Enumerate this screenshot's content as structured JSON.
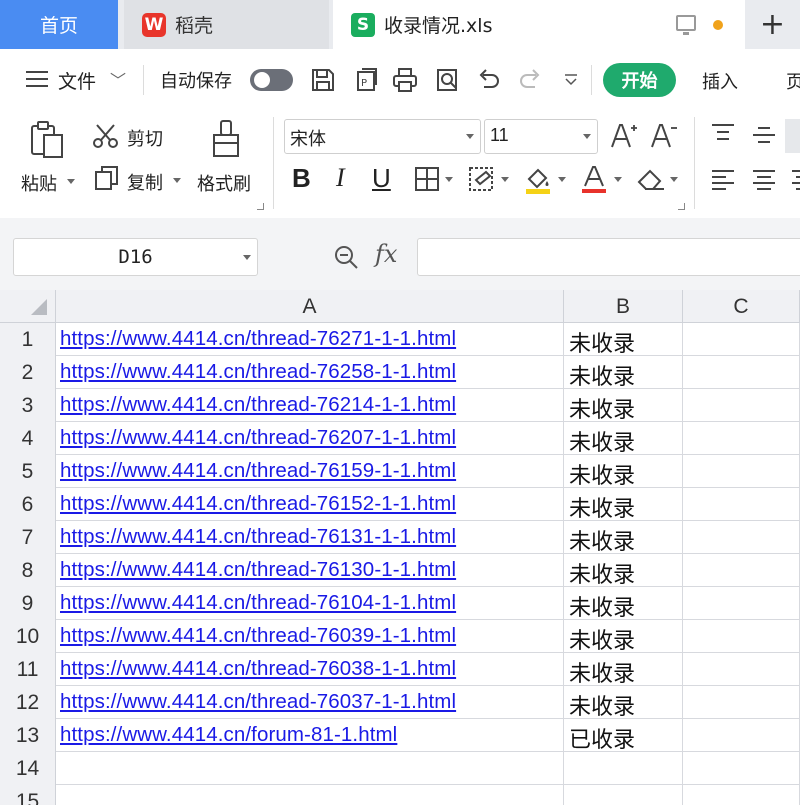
{
  "tabs": {
    "home": "首页",
    "daoke": "稻壳",
    "daoke_logo": "W",
    "file": "收录情况.xls",
    "file_logo": "S",
    "new_tab": "+"
  },
  "menu": {
    "file": "文件",
    "chevron": "﹀",
    "autosave": "自动保存",
    "start": "开始",
    "insert": "插入",
    "more": "页"
  },
  "ribbon": {
    "paste": "粘贴",
    "cut": "剪切",
    "copy": "复制",
    "format_painter": "格式刷",
    "font_name": "宋体",
    "font_size": "11",
    "bold": "B",
    "italic": "I",
    "underline": "U"
  },
  "formula_bar": {
    "name_box": "D16",
    "fx": "fx",
    "formula": ""
  },
  "sheet": {
    "columns": [
      "A",
      "B",
      "C"
    ],
    "rows": [
      {
        "num": "1",
        "url": "https://www.4414.cn/thread-76271-1-1.html",
        "status": "未收录"
      },
      {
        "num": "2",
        "url": "https://www.4414.cn/thread-76258-1-1.html",
        "status": "未收录"
      },
      {
        "num": "3",
        "url": "https://www.4414.cn/thread-76214-1-1.html",
        "status": "未收录"
      },
      {
        "num": "4",
        "url": "https://www.4414.cn/thread-76207-1-1.html",
        "status": "未收录"
      },
      {
        "num": "5",
        "url": "https://www.4414.cn/thread-76159-1-1.html",
        "status": "未收录"
      },
      {
        "num": "6",
        "url": "https://www.4414.cn/thread-76152-1-1.html",
        "status": "未收录"
      },
      {
        "num": "7",
        "url": "https://www.4414.cn/thread-76131-1-1.html",
        "status": "未收录"
      },
      {
        "num": "8",
        "url": "https://www.4414.cn/thread-76130-1-1.html",
        "status": "未收录"
      },
      {
        "num": "9",
        "url": "https://www.4414.cn/thread-76104-1-1.html",
        "status": "未收录"
      },
      {
        "num": "10",
        "url": "https://www.4414.cn/thread-76039-1-1.html",
        "status": "未收录"
      },
      {
        "num": "11",
        "url": "https://www.4414.cn/thread-76038-1-1.html",
        "status": "未收录"
      },
      {
        "num": "12",
        "url": "https://www.4414.cn/thread-76037-1-1.html",
        "status": "未收录"
      },
      {
        "num": "13",
        "url": "https://www.4414.cn/forum-81-1.html",
        "status": "已收录"
      },
      {
        "num": "14",
        "url": "",
        "status": ""
      },
      {
        "num": "15",
        "url": "",
        "status": ""
      }
    ]
  },
  "colors": {
    "home_tab": "#4a8cf2",
    "start_button": "#1faa6d",
    "link": "#1a1ae6",
    "file_icon": "#1aad5e",
    "daoke_icon": "#e8352b"
  }
}
